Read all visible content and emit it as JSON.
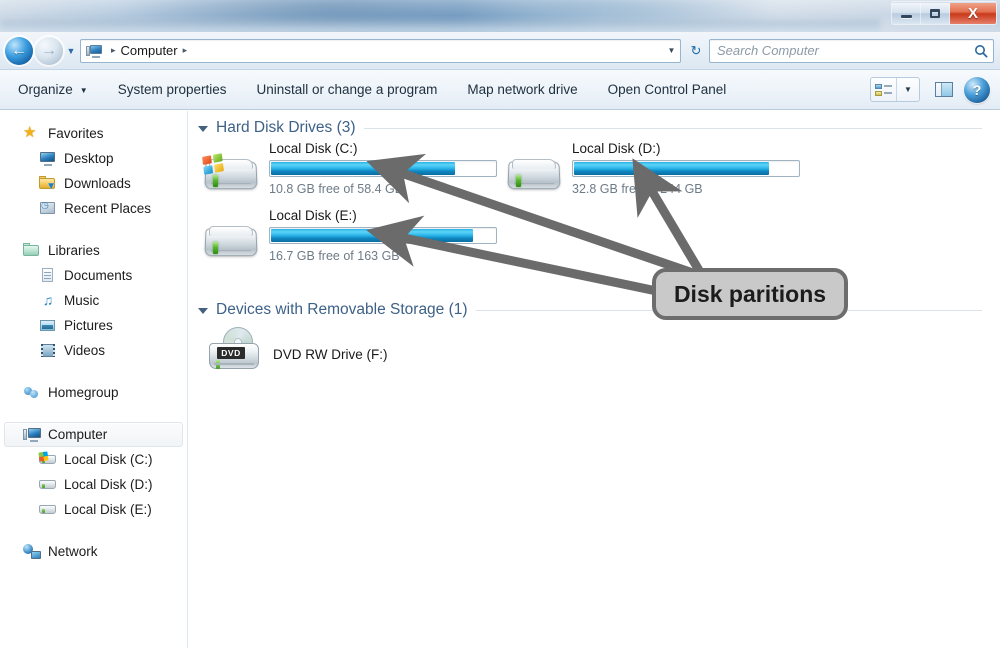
{
  "window": {
    "minimize_label": "Minimize",
    "maximize_label": "Maximize",
    "close_label": "X"
  },
  "navbar": {
    "back_glyph": "←",
    "forward_glyph": "→",
    "history_glyph": "▼",
    "breadcrumb_icon": "computer-icon",
    "breadcrumb_sep1": "▸",
    "breadcrumb_root": "Computer",
    "breadcrumb_sep2": "▸",
    "address_dropdown_glyph": "▼",
    "refresh_glyph": "↻",
    "search_placeholder": "Search Computer",
    "search_value": "",
    "search_icon_glyph": "⚲"
  },
  "toolbar": {
    "items": [
      {
        "label": "Organize",
        "has_caret": true,
        "caret": "▼"
      },
      {
        "label": "System properties",
        "has_caret": false,
        "caret": ""
      },
      {
        "label": "Uninstall or change a program",
        "has_caret": false,
        "caret": ""
      },
      {
        "label": "Map network drive",
        "has_caret": false,
        "caret": ""
      },
      {
        "label": "Open Control Panel",
        "has_caret": false,
        "caret": ""
      }
    ],
    "view_icon": "view-options-icon",
    "view_dropdown_glyph": "▼",
    "preview_pane_icon": "preview-pane-icon",
    "help_glyph": "?"
  },
  "sidebar": {
    "groups": [
      {
        "header": {
          "label": "Favorites",
          "icon": "star-icon"
        },
        "items": [
          {
            "label": "Desktop",
            "icon": "desktop-icon"
          },
          {
            "label": "Downloads",
            "icon": "downloads-folder-icon"
          },
          {
            "label": "Recent Places",
            "icon": "recent-places-icon"
          }
        ]
      },
      {
        "header": {
          "label": "Libraries",
          "icon": "libraries-folder-icon"
        },
        "items": [
          {
            "label": "Documents",
            "icon": "document-icon"
          },
          {
            "label": "Music",
            "icon": "music-note-icon"
          },
          {
            "label": "Pictures",
            "icon": "picture-icon"
          },
          {
            "label": "Videos",
            "icon": "video-icon"
          }
        ]
      },
      {
        "header": {
          "label": "Homegroup",
          "icon": "homegroup-icon"
        },
        "items": []
      },
      {
        "header": {
          "label": "Computer",
          "icon": "computer-icon",
          "selected": true
        },
        "items": [
          {
            "label": "Local Disk (C:)",
            "icon": "hard-drive-windows-icon"
          },
          {
            "label": "Local Disk (D:)",
            "icon": "hard-drive-icon"
          },
          {
            "label": "Local Disk (E:)",
            "icon": "hard-drive-icon"
          }
        ]
      },
      {
        "header": {
          "label": "Network",
          "icon": "network-icon"
        },
        "items": []
      }
    ]
  },
  "content": {
    "groups": [
      {
        "title": "Hard Disk Drives (3)",
        "caret": "collapse-caret-icon",
        "drives": [
          {
            "name": "Local Disk (C:)",
            "icon": "hard-drive-windows-icon",
            "free_text": "10.8 GB free of 58.4 GB",
            "free_gb": 10.8,
            "total_gb": 58.4,
            "used_percent": 82
          },
          {
            "name": "Local Disk (D:)",
            "icon": "hard-drive-icon",
            "free_text": "32.8 GB free of 244 GB",
            "free_gb": 32.8,
            "total_gb": 244,
            "used_percent": 87
          },
          {
            "name": "Local Disk (E:)",
            "icon": "hard-drive-icon",
            "free_text": "16.7 GB free of 163 GB",
            "free_gb": 16.7,
            "total_gb": 163,
            "used_percent": 90
          }
        ]
      },
      {
        "title": "Devices with Removable Storage (1)",
        "caret": "collapse-caret-icon",
        "devices": [
          {
            "name": "DVD RW Drive (F:)",
            "icon": "dvd-drive-icon",
            "badge": "DVD"
          }
        ]
      }
    ]
  },
  "annotation": {
    "callout_text": "Disk paritions",
    "callout_color": "#c9c9c9",
    "callout_border": "#6d6d6d",
    "arrow_color": "#6b6b6b",
    "arrows": [
      {
        "target": "Local Disk (C:)"
      },
      {
        "target": "Local Disk (D:)"
      },
      {
        "target": "Local Disk (E:)"
      }
    ]
  }
}
